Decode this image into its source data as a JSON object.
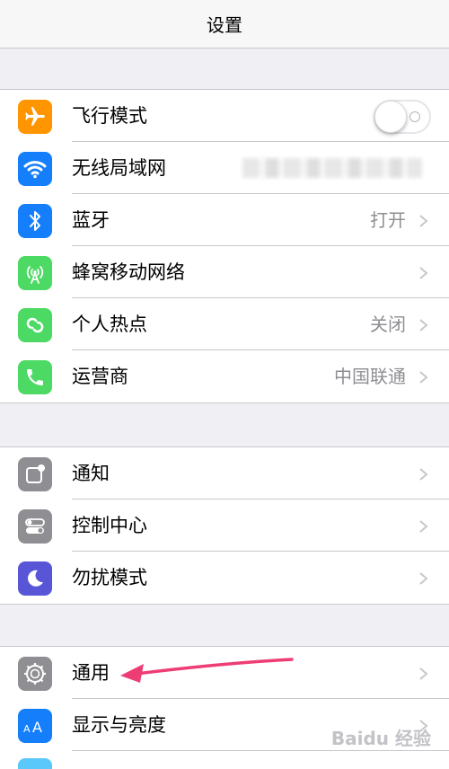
{
  "navbar": {
    "title": "设置"
  },
  "group1": {
    "items": [
      {
        "label": "飞行模式",
        "icon": "airplane-icon",
        "color": "#ff9500",
        "toggle": "off"
      },
      {
        "label": "无线局域网",
        "icon": "wifi-icon",
        "color": "#147efb",
        "value_blurred": true
      },
      {
        "label": "蓝牙",
        "icon": "bluetooth-icon",
        "color": "#147efb",
        "value": "打开"
      },
      {
        "label": "蜂窝移动网络",
        "icon": "cellular-icon",
        "color": "#4cd964",
        "value": ""
      },
      {
        "label": "个人热点",
        "icon": "hotspot-icon",
        "color": "#4cd964",
        "value": "关闭"
      },
      {
        "label": "运营商",
        "icon": "phone-icon",
        "color": "#4cd964",
        "value": "中国联通"
      }
    ]
  },
  "group2": {
    "items": [
      {
        "label": "通知",
        "icon": "notifications-icon",
        "color": "#8e8e93"
      },
      {
        "label": "控制中心",
        "icon": "control-center-icon",
        "color": "#8e8e93"
      },
      {
        "label": "勿扰模式",
        "icon": "moon-icon",
        "color": "#5856d6"
      }
    ]
  },
  "group3": {
    "items": [
      {
        "label": "通用",
        "icon": "gear-icon",
        "color": "#8e8e93"
      },
      {
        "label": "显示与亮度",
        "icon": "display-brightness-icon",
        "color": "#147efb"
      }
    ]
  },
  "watermark": "Baidu 经验"
}
